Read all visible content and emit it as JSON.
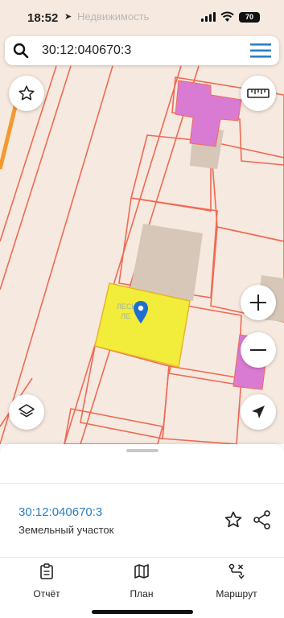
{
  "status": {
    "time": "18:52",
    "app_label": "Недвижимость",
    "battery": "70"
  },
  "search": {
    "value": "30:12:040670:3"
  },
  "map": {
    "watermark_line1": "ЛЕСНЫЕ",
    "watermark_line2": "ЛЕ",
    "colors": {
      "background": "#f6e9df",
      "parcel_border": "#ef6a55",
      "selected_parcel": "#f2ec3a",
      "building": "#d4c3b3",
      "highlight_building": "#d97bd3",
      "pin": "#1f6fd1"
    }
  },
  "controls": {
    "favorite_icon": "star-icon",
    "ruler_icon": "ruler-icon",
    "zoom_in_icon": "plus-icon",
    "zoom_out_icon": "minus-icon",
    "layers_icon": "layers-icon",
    "locate_icon": "navigation-arrow-icon"
  },
  "sheet": {
    "parcel_number": "30:12:040670:3",
    "parcel_type": "Земельный участок"
  },
  "tabs": [
    {
      "label": "Отчёт",
      "icon": "report-icon"
    },
    {
      "label": "План",
      "icon": "map-plan-icon"
    },
    {
      "label": "Маршрут",
      "icon": "route-icon"
    }
  ]
}
